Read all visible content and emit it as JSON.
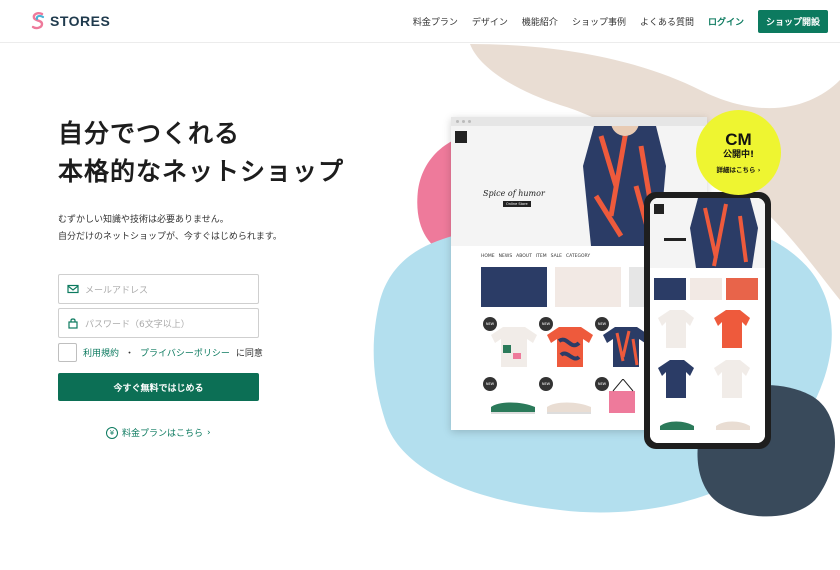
{
  "brand": {
    "name": "STORES"
  },
  "nav": {
    "items": [
      "料金プラン",
      "デザイン",
      "機能紹介",
      "ショップ事例",
      "よくある質問"
    ],
    "login": "ログイン",
    "open_shop": "ショップ開設"
  },
  "hero": {
    "headline_line1": "自分でつくれる",
    "headline_line2": "本格的なネットショップ",
    "sub_line1": "むずかしい知識や技術は必要ありません。",
    "sub_line2": "自分だけのネットショップが、今すぐはじめられます。"
  },
  "form": {
    "email_placeholder": "メールアドレス",
    "password_placeholder": "パスワード（6文字以上）",
    "terms_link": "利用規約",
    "separator": "・",
    "privacy_link": "プライバシーポリシー",
    "agree_suffix": "に同意",
    "submit": "今すぐ無料ではじめる"
  },
  "pricing_link": {
    "label": "料金プランはこちら",
    "icon": "yen-icon"
  },
  "mockup": {
    "brand_script": "Spice of humor",
    "brand_tag": "Online Store",
    "store_nav": [
      "HOME",
      "NEWS",
      "ABOUT",
      "ITEM",
      "SALE",
      "CATEGORY"
    ],
    "new_badge": "NEW"
  },
  "cm_badge": {
    "big": "CM",
    "mid": "公開中!",
    "small": "詳細はこちら ›"
  },
  "colors": {
    "accent": "#0c7a5f",
    "cta": "#0c6f55",
    "pink_blob": "#ee7a9b",
    "blue_blob": "#b3dfee",
    "navy_blob": "#394a5b",
    "cm_yellow": "#eef531"
  }
}
